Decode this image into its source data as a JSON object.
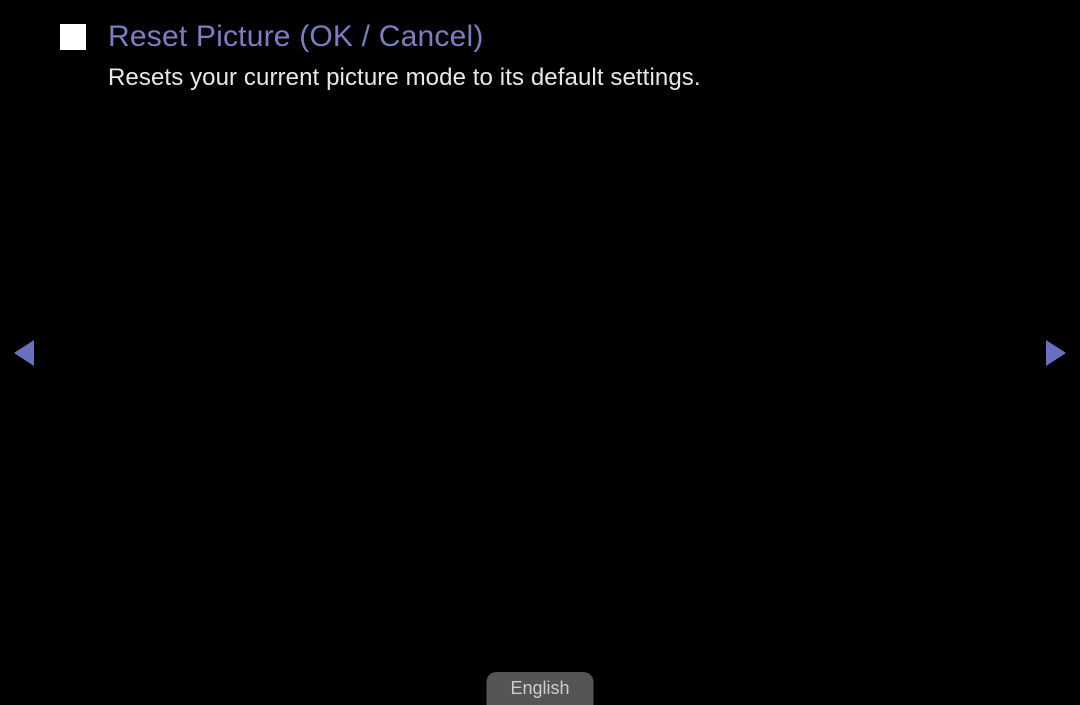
{
  "title": "Reset Picture (OK / Cancel)",
  "description": "Resets your current picture mode to its default settings.",
  "language_label": "English",
  "colors": {
    "title_accent": "#7a7fc2",
    "arrow_accent": "#6a70c0",
    "background": "#000000",
    "body_text": "#e8e8e8"
  },
  "icons": {
    "bullet": "square-bullet-icon",
    "prev": "triangle-left-icon",
    "next": "triangle-right-icon"
  }
}
